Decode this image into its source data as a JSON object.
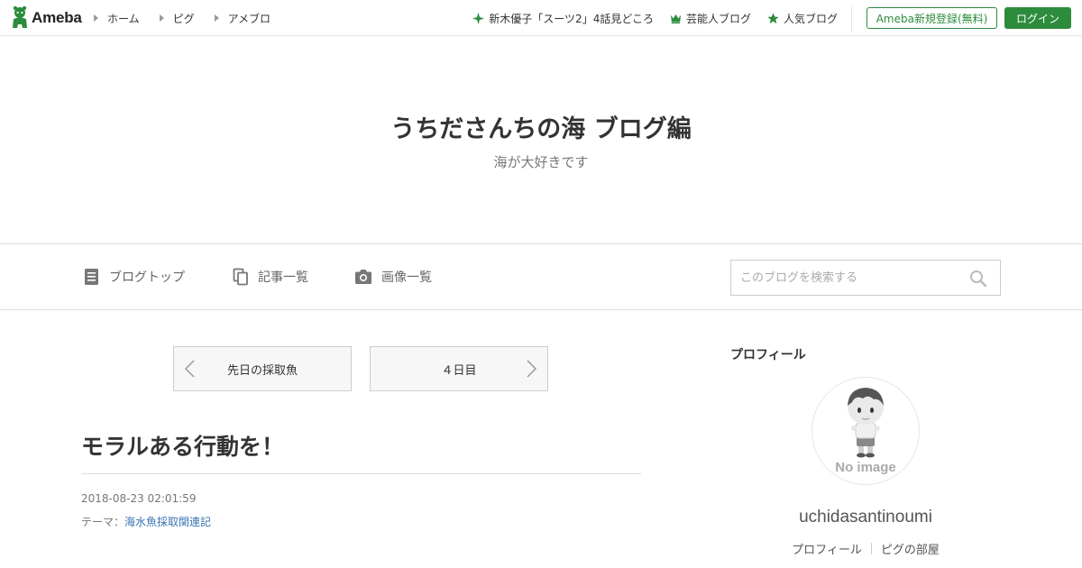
{
  "header": {
    "logo_text": "Ameba",
    "nav_left": [
      {
        "label": "ホーム"
      },
      {
        "label": "ピグ"
      },
      {
        "label": "アメブロ"
      }
    ],
    "nav_right": [
      {
        "label": "新木優子「スーツ2」4話見どころ",
        "icon": "sparkle-icon"
      },
      {
        "label": "芸能人ブログ",
        "icon": "crown-icon"
      },
      {
        "label": "人気ブログ",
        "icon": "star-icon"
      }
    ],
    "register_label": "Ameba新規登録(無料)",
    "login_label": "ログイン"
  },
  "blog": {
    "title": "うちださんちの海 ブログ編",
    "description": "海が大好きです"
  },
  "blog_nav": {
    "items": [
      {
        "label": "ブログトップ",
        "icon": "document-icon"
      },
      {
        "label": "記事一覧",
        "icon": "copy-icon"
      },
      {
        "label": "画像一覧",
        "icon": "camera-icon"
      }
    ],
    "search_placeholder": "このブログを検索する"
  },
  "pager": {
    "prev_label": "先日の採取魚",
    "next_label": "４日目"
  },
  "article": {
    "title": "モラルある行動を！",
    "date": "2018-08-23 02:01:59",
    "theme_prefix": "テーマ：",
    "theme_link": "海水魚採取関連記"
  },
  "sidebar": {
    "heading": "プロフィール",
    "avatar_text": "No image",
    "username": "uchidasantinoumi",
    "links": [
      {
        "label": "プロフィール"
      },
      {
        "label": "ピグの部屋"
      }
    ]
  },
  "colors": {
    "brand_green": "#2d8c3c",
    "link_blue": "#3a74b0"
  }
}
